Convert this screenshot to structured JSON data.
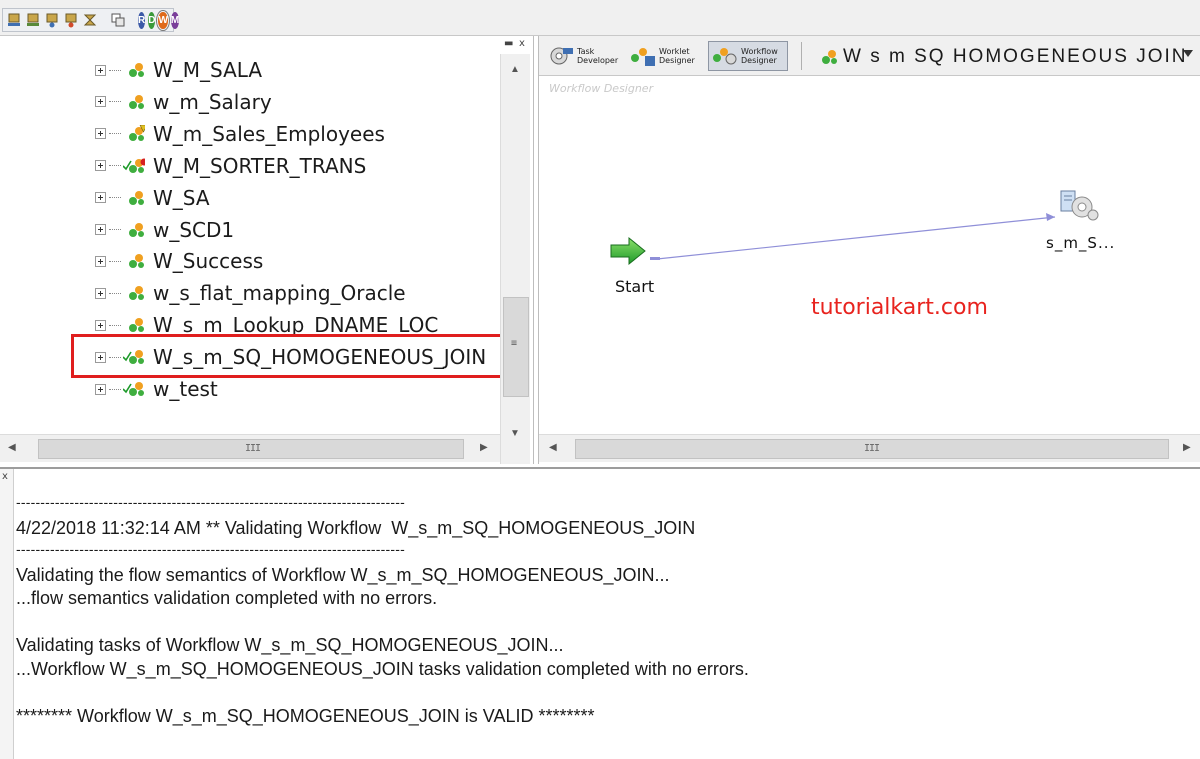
{
  "toolbar": {
    "icons": [
      "repository-connect-icon",
      "repository-disconnect-icon",
      "folder-open-icon",
      "folder-close-icon",
      "properties-icon",
      "options-icon"
    ],
    "client_buttons": [
      {
        "letter": "R",
        "name": "repository-manager",
        "color": "#3c5aa8"
      },
      {
        "letter": "D",
        "name": "designer",
        "color": "#3a9a3a"
      },
      {
        "letter": "W",
        "name": "workflow-manager",
        "color": "#e06a1a"
      },
      {
        "letter": "M",
        "name": "workflow-monitor",
        "color": "#7a3d9a"
      }
    ]
  },
  "navigator": {
    "items": [
      {
        "label": "W_M_SALA",
        "status": "none"
      },
      {
        "label": "w_m_Salary",
        "status": "none"
      },
      {
        "label": "W_m_Sales_Employees",
        "status": "warning"
      },
      {
        "label": "W_M_SORTER_TRANS",
        "status": "error"
      },
      {
        "label": "W_SA",
        "status": "none"
      },
      {
        "label": "w_SCD1",
        "status": "none"
      },
      {
        "label": "W_Success",
        "status": "none"
      },
      {
        "label": "w_s_flat_mapping_Oracle",
        "status": "none"
      },
      {
        "label": "W_s_m_Lookup_DNAME_LOC",
        "status": "none"
      },
      {
        "label": "W_s_m_SQ_HOMOGENEOUS_JOIN",
        "status": "valid",
        "highlighted": true
      },
      {
        "label": "w_test",
        "status": "valid"
      }
    ],
    "panel_controls": "x"
  },
  "designer": {
    "tabs": [
      {
        "label": "Task\nDeveloper",
        "active": false
      },
      {
        "label": "Worklet\nDesigner",
        "active": false
      },
      {
        "label": "Workflow\nDesigner",
        "active": true
      }
    ],
    "workflow_name": "W_s_m_SQ_HOMOGENEOUS_JOIN",
    "workflow_title_display": "W s m SQ HOMOGENEOUS JOIN",
    "canvas_label": "Workflow Designer",
    "start_label": "Start",
    "session_label": "s_m_S...",
    "watermark": "tutorialkart.com"
  },
  "output": {
    "close_label": "x",
    "lines": [
      {
        "type": "dash",
        "text": "--------------------------------------------------------------------------------"
      },
      {
        "type": "text",
        "text": "4/22/2018 11:32:14 AM ** Validating Workflow  W_s_m_SQ_HOMOGENEOUS_JOIN"
      },
      {
        "type": "dash",
        "text": "--------------------------------------------------------------------------------"
      },
      {
        "type": "text",
        "text": "Validating the flow semantics of Workflow W_s_m_SQ_HOMOGENEOUS_JOIN..."
      },
      {
        "type": "text",
        "text": "...flow semantics validation completed with no errors."
      },
      {
        "type": "text",
        "text": ""
      },
      {
        "type": "text",
        "text": "Validating tasks of Workflow W_s_m_SQ_HOMOGENEOUS_JOIN..."
      },
      {
        "type": "text",
        "text": "...Workflow W_s_m_SQ_HOMOGENEOUS_JOIN tasks validation completed with no errors."
      },
      {
        "type": "text",
        "text": ""
      },
      {
        "type": "text",
        "text": "******** Workflow W_s_m_SQ_HOMOGENEOUS_JOIN is VALID ********"
      }
    ]
  },
  "scrollbars": {
    "grip_label": "III"
  }
}
